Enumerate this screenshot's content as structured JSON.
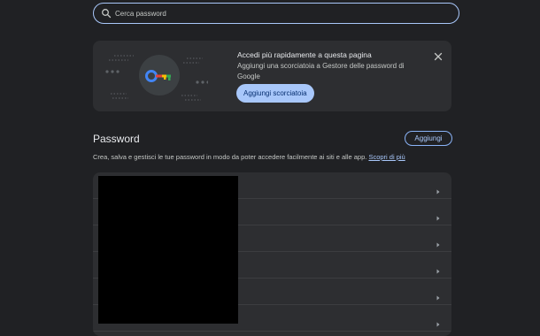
{
  "search": {
    "placeholder": "Cerca password"
  },
  "promo": {
    "title": "Accedi più rapidamente a questa pagina",
    "description": "Aggiungi una scorciatoia a Gestore delle password di Google",
    "button_label": "Aggiungi scorciatoia",
    "illustration_icon": "key-icon",
    "close_icon": "close-icon"
  },
  "section": {
    "title": "Password",
    "add_label": "Aggiungi",
    "description": "Crea, salva e gestisci le tue password in modo da poter accedere facilmente ai siti e alle app.",
    "learn_more": "Scopri di più"
  },
  "list": {
    "row_count": 6,
    "row_icon": "chevron-right-icon"
  },
  "colors": {
    "background": "#202124",
    "surface": "#2d2e31",
    "accent": "#a8c7fa",
    "accent_text": "#062e6f"
  }
}
